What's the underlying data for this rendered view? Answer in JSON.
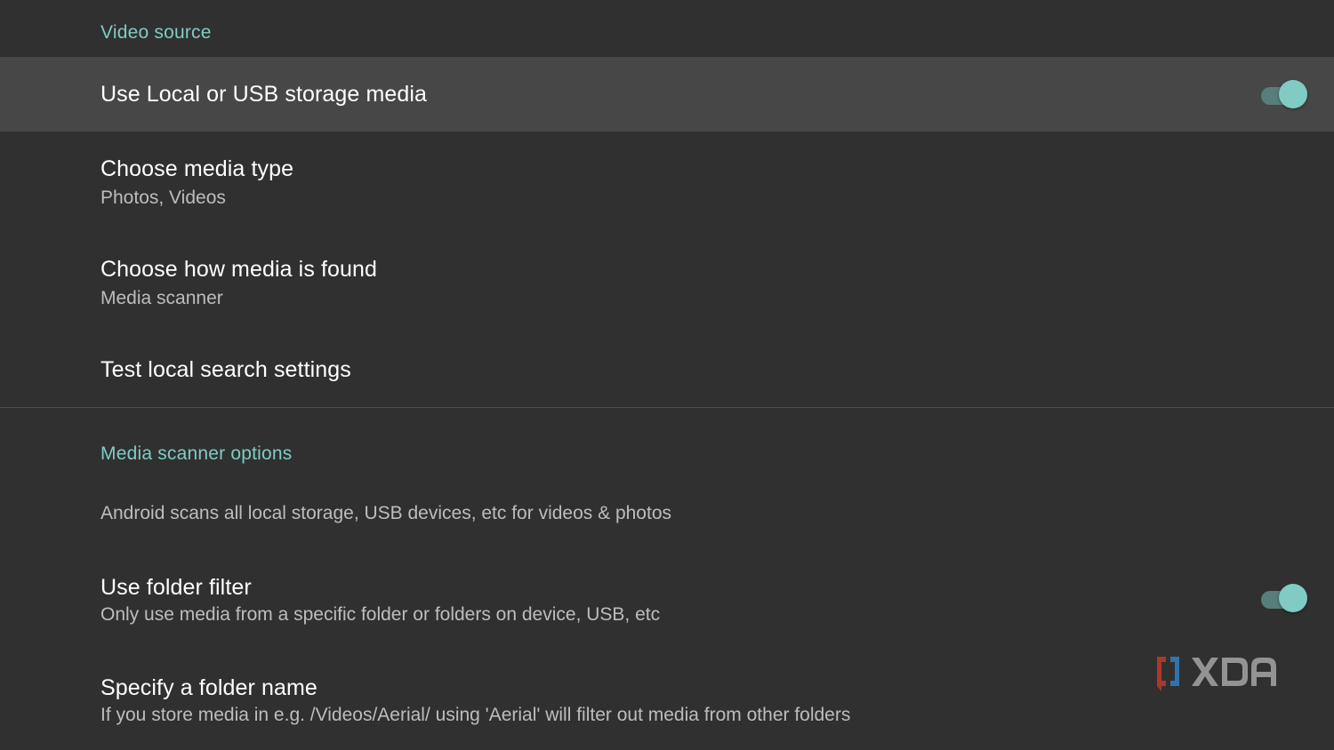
{
  "colors": {
    "background": "#303030",
    "focused_row": "#474747",
    "accent": "#80cbc4",
    "title_text": "#ffffff",
    "summary_text": "#bdbdbd",
    "toggle_track": "#577e7b"
  },
  "video_source": {
    "header": "Video source",
    "use_local": {
      "title": "Use Local or USB storage media",
      "toggle_on": true
    },
    "media_type": {
      "title": "Choose media type",
      "summary": "Photos, Videos"
    },
    "media_found": {
      "title": "Choose how media is found",
      "summary": "Media scanner"
    },
    "test_search": {
      "title": "Test local search settings"
    }
  },
  "scanner_options": {
    "header": "Media scanner options",
    "info": "Android scans all local storage, USB devices, etc for videos & photos",
    "folder_filter": {
      "title": "Use folder filter",
      "summary": "Only use media from a specific folder or folders on device, USB, etc",
      "toggle_on": true
    },
    "folder_name": {
      "title": "Specify a folder name",
      "summary": "If you store media in e.g. /Videos/Aerial/ using 'Aerial' will filter out media from other folders"
    }
  },
  "watermark": {
    "text": "XDA"
  }
}
